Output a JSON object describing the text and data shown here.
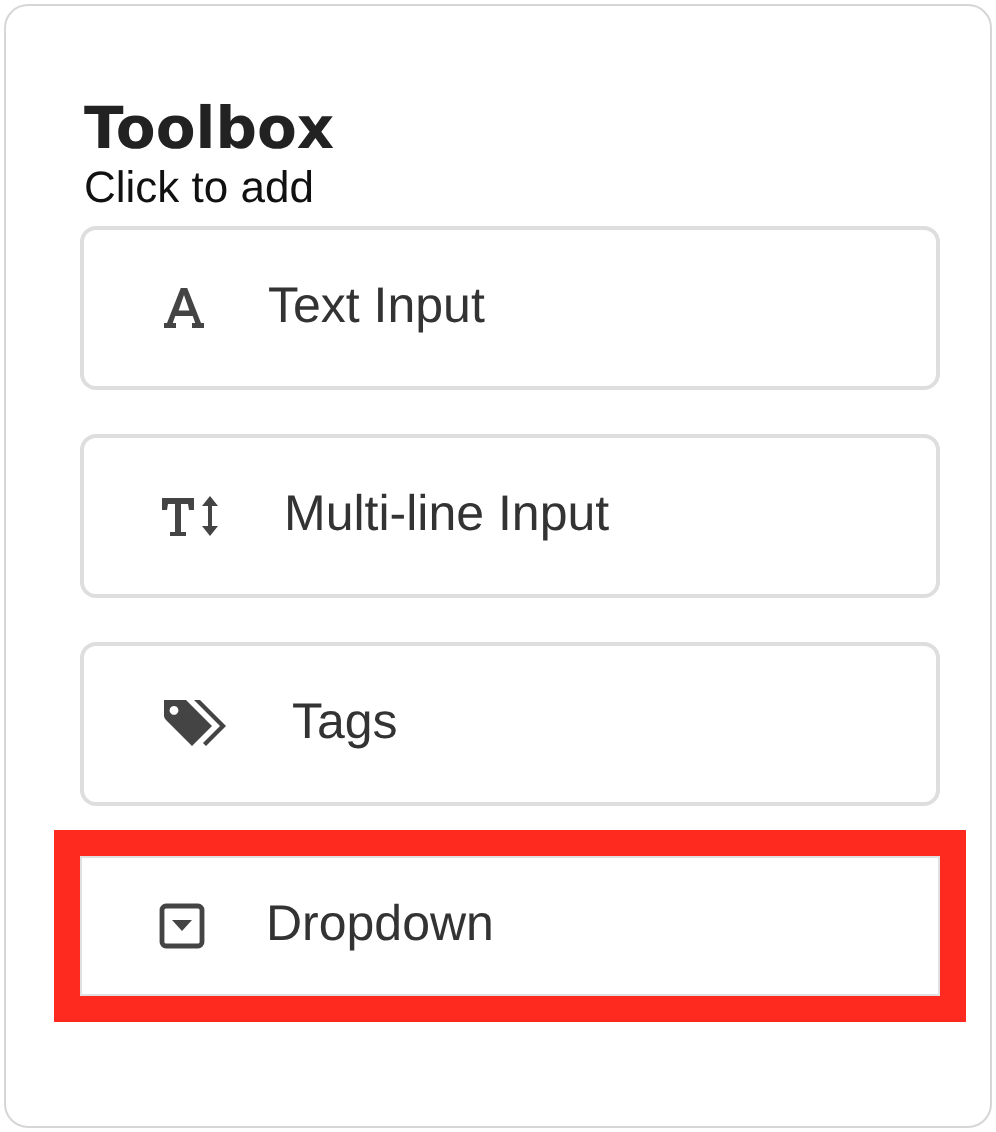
{
  "toolbox": {
    "title": "Toolbox",
    "subtitle": "Click to add",
    "items": [
      {
        "kind": "text",
        "label": "Text Input",
        "highlighted": false
      },
      {
        "kind": "multiline",
        "label": "Multi-line Input",
        "highlighted": false
      },
      {
        "kind": "tags",
        "label": "Tags",
        "highlighted": false
      },
      {
        "kind": "dropdown",
        "label": "Dropdown",
        "highlighted": true
      }
    ]
  }
}
